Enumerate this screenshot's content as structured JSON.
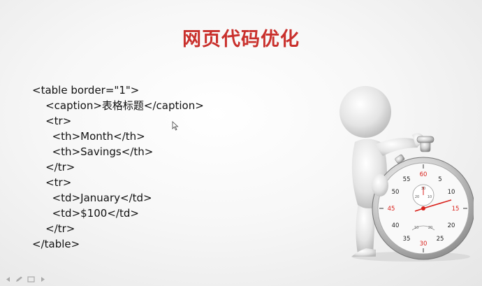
{
  "slide": {
    "title": "网页代码优化",
    "code_lines": [
      "<table border=\"1\">",
      "    <caption>表格标题</caption>",
      "    <tr>",
      "      <th>Month</th>",
      "      <th>Savings</th>",
      "    </tr>",
      "    <tr>",
      "      <td>January</td>",
      "      <td>$100</td>",
      "    </tr>",
      "</table>"
    ],
    "stopwatch": {
      "numbers": [
        "60",
        "5",
        "10",
        "15",
        "20",
        "25",
        "30",
        "35",
        "40",
        "45",
        "50",
        "55"
      ],
      "sub_dial_top": [
        "30",
        "10",
        "20"
      ],
      "sub_dial_bottom": [
        "10",
        "20"
      ]
    }
  },
  "colors": {
    "title": "#c9302c",
    "code": "#111111",
    "dial_red": "#d9221c"
  },
  "icons": [
    "cursor-icon",
    "prev-slide-icon",
    "pen-icon",
    "slides-icon",
    "next-slide-icon"
  ]
}
